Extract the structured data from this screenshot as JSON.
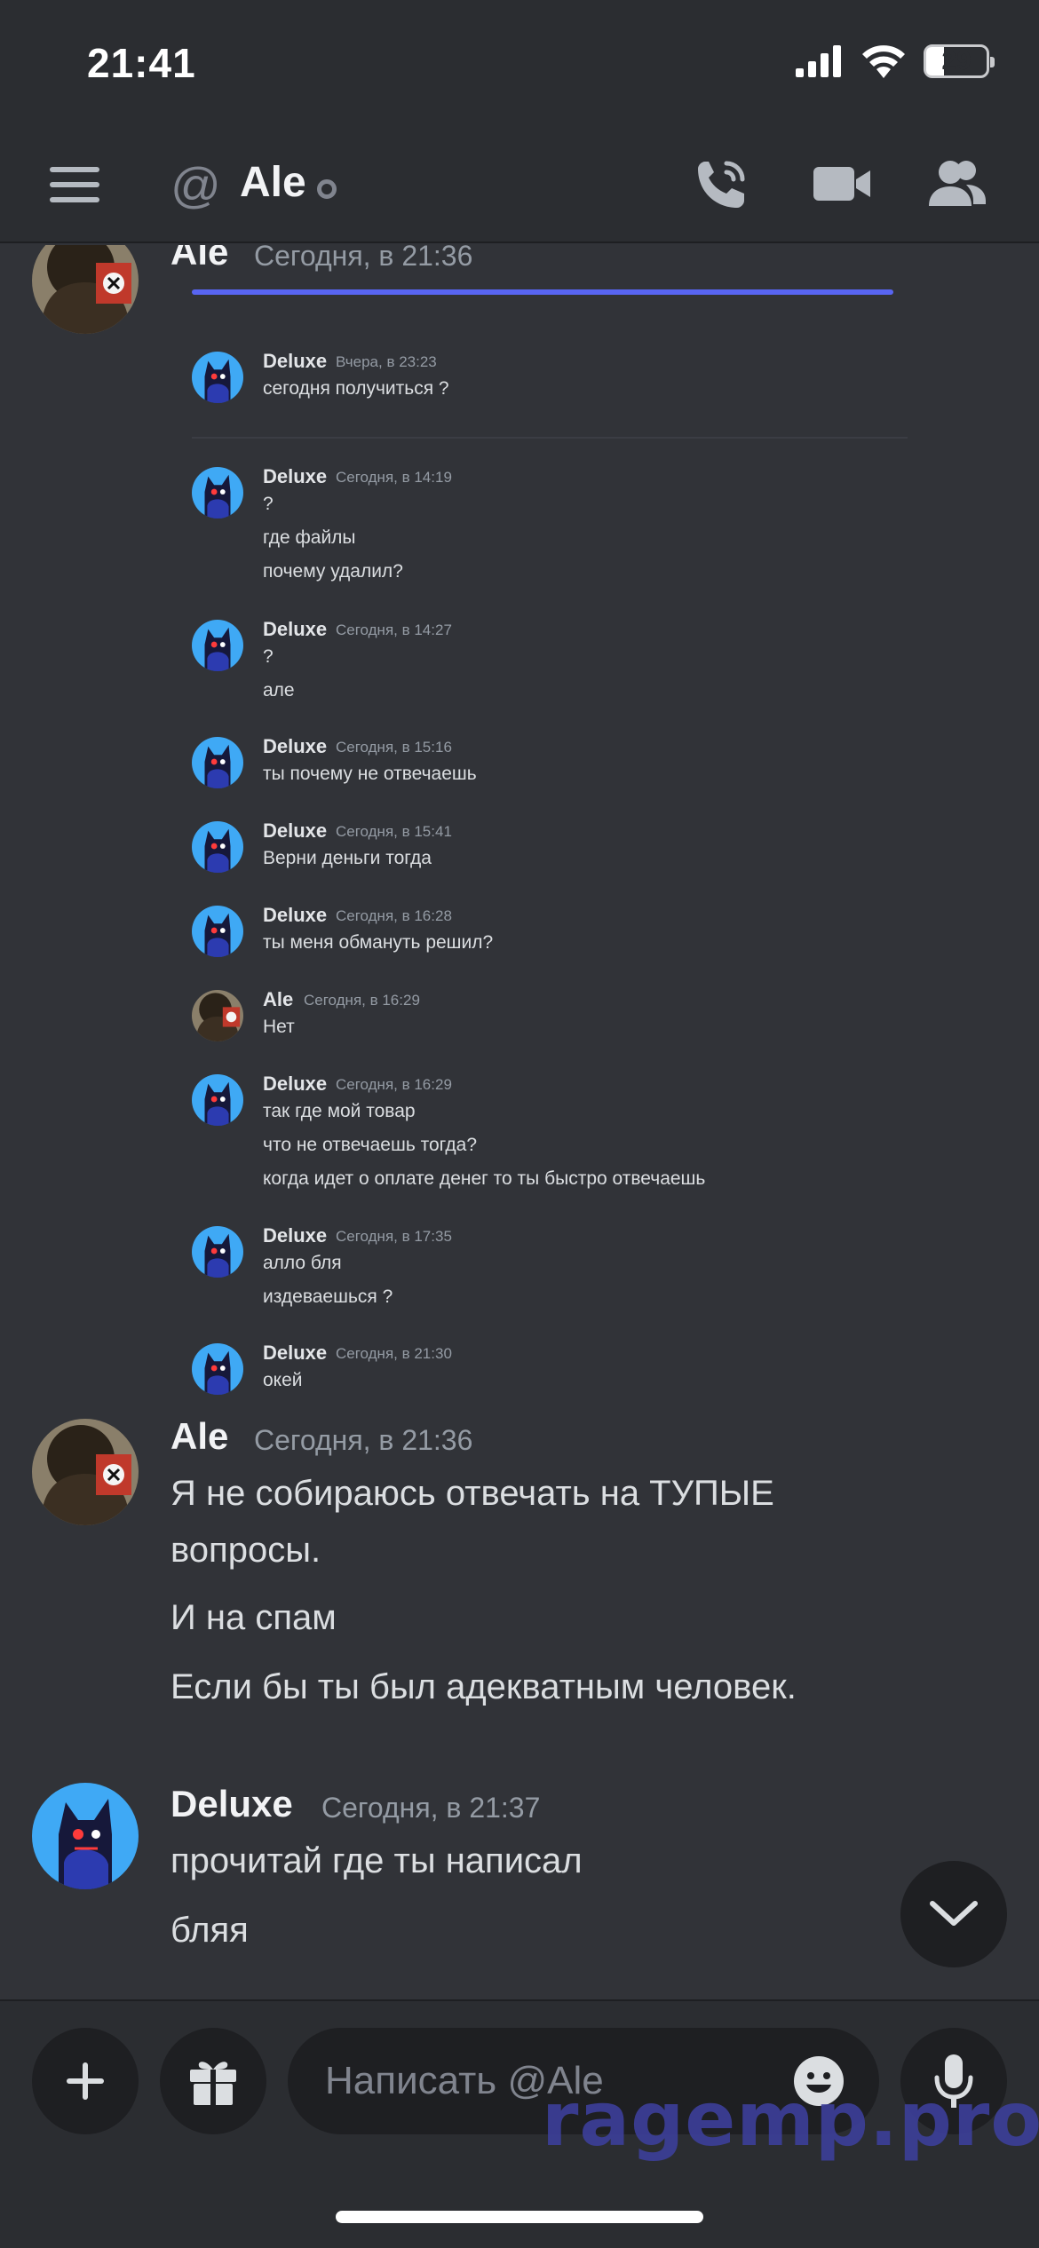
{
  "status_bar": {
    "time": "21:41",
    "battery_level": "29",
    "battery_fraction": 0.29,
    "icons": [
      "signal-icon",
      "wifi-icon",
      "battery-icon"
    ]
  },
  "header": {
    "channel_prefix": "@",
    "title": "Ale",
    "icons": [
      "menu-icon",
      "at-icon",
      "status-dot-icon",
      "voice-call-icon",
      "video-call-icon",
      "members-icon"
    ]
  },
  "messages": [
    {
      "author": "Ale",
      "timestamp": "Сегодня, в 21:36",
      "avatar": "ale-avatar",
      "screenshot": {
        "messages": [
          {
            "author": "Deluxe",
            "timestamp": "Вчера, в 23:23",
            "lines": [
              "сегодня получиться ?"
            ]
          },
          {
            "author": "Deluxe",
            "timestamp": "Сегодня, в 14:19",
            "lines": [
              "?",
              "где файлы",
              "почему удалил?"
            ]
          },
          {
            "author": "Deluxe",
            "timestamp": "Сегодня, в 14:27",
            "lines": [
              "?",
              "але"
            ]
          },
          {
            "author": "Deluxe",
            "timestamp": "Сегодня, в 15:16",
            "lines": [
              "ты почему не отвечаешь"
            ]
          },
          {
            "author": "Deluxe",
            "timestamp": "Сегодня, в 15:41",
            "lines": [
              "Верни деньги тогда"
            ]
          },
          {
            "author": "Deluxe",
            "timestamp": "Сегодня, в 16:28",
            "lines": [
              "ты меня обмануть решил?"
            ]
          },
          {
            "author": "Ale",
            "timestamp": "Сегодня, в 16:29",
            "lines": [
              "Нет"
            ]
          },
          {
            "author": "Deluxe",
            "timestamp": "Сегодня, в 16:29",
            "lines": [
              "так где мой товар",
              "что не отвечаешь тогда?",
              "когда идет о оплате денег то ты быстро отвечаешь"
            ]
          },
          {
            "author": "Deluxe",
            "timestamp": "Сегодня, в 17:35",
            "lines": [
              "алло бля",
              "издеваешься ?"
            ]
          },
          {
            "author": "Deluxe",
            "timestamp": "Сегодня, в 21:30",
            "lines": [
              "окей"
            ]
          }
        ]
      }
    },
    {
      "author": "Ale",
      "timestamp": "Сегодня, в 21:36",
      "avatar": "ale-avatar",
      "lines": [
        "Я не собираюсь отвечать на ТУПЫЕ",
        "вопросы.",
        "И на спам",
        "Если бы ты был адекватным человек."
      ]
    },
    {
      "author": "Deluxe",
      "timestamp": "Сегодня, в 21:37",
      "avatar": "deluxe-avatar",
      "lines": [
        "прочитай где ты написал",
        "бляя"
      ]
    }
  ],
  "composer": {
    "placeholder": "Написать @Ale",
    "value": "",
    "icons": [
      "plus-icon",
      "gift-icon",
      "emoji-icon",
      "microphone-icon",
      "chevron-down-icon"
    ]
  },
  "watermark": "ragemp.pro",
  "colors": {
    "background": "#313338",
    "header": "#2b2d31",
    "accent": "#5865f2",
    "muted": "#949ba4"
  }
}
